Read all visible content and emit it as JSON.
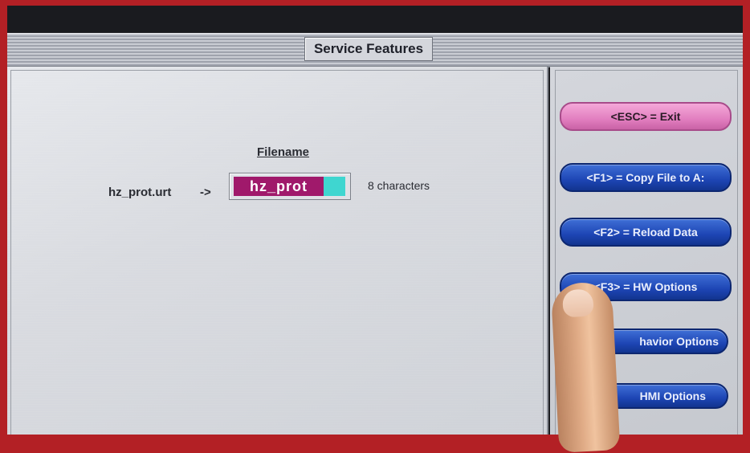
{
  "window": {
    "title": "Service Features"
  },
  "main": {
    "filename_heading": "Filename",
    "source_file": "hz_prot.urt",
    "arrow": "->",
    "filename_value": "hz_prot",
    "char_count": "8 characters"
  },
  "side_buttons": [
    {
      "label": "<ESC> = Exit",
      "style": "pink"
    },
    {
      "label": "<F1> = Copy File to A:",
      "style": "blue"
    },
    {
      "label": "<F2> = Reload Data",
      "style": "blue"
    },
    {
      "label": "<F3> = HW Options",
      "style": "blue"
    },
    {
      "label": "havior Options",
      "style": "blue"
    },
    {
      "label": "HMI Options",
      "style": "blue"
    }
  ],
  "colors": {
    "filename_field": "#a0196b",
    "cursor": "#3fd6d0",
    "exit_button": "#e27fc0",
    "function_button": "#1d45b4"
  }
}
